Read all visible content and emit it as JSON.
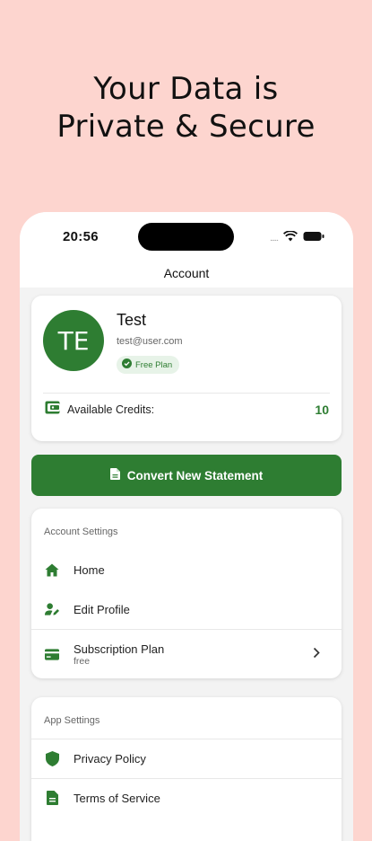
{
  "headline": {
    "line1": "Your Data is",
    "line2": "Private & Secure"
  },
  "status_bar": {
    "time": "20:56",
    "signal_dots": "....."
  },
  "nav": {
    "title": "Account"
  },
  "profile": {
    "initials": "TE",
    "name": "Test",
    "email": "test@user.com",
    "plan_badge": "Free Plan",
    "credits_label": "Available Credits:",
    "credits_value": "10"
  },
  "convert_button": {
    "label": "Convert New Statement"
  },
  "account_settings": {
    "title": "Account Settings",
    "items": [
      {
        "label": "Home",
        "icon": "home-icon"
      },
      {
        "label": "Edit Profile",
        "icon": "edit-profile-icon"
      },
      {
        "label": "Subscription Plan",
        "sub": "free",
        "icon": "credit-card-icon"
      }
    ]
  },
  "app_settings": {
    "title": "App Settings",
    "items": [
      {
        "label": "Privacy Policy",
        "icon": "shield-icon"
      },
      {
        "label": "Terms of Service",
        "icon": "document-icon"
      }
    ]
  },
  "colors": {
    "background": "#fdd5cf",
    "accent": "#2e7d32",
    "badge_bg": "#e7f3e8"
  }
}
